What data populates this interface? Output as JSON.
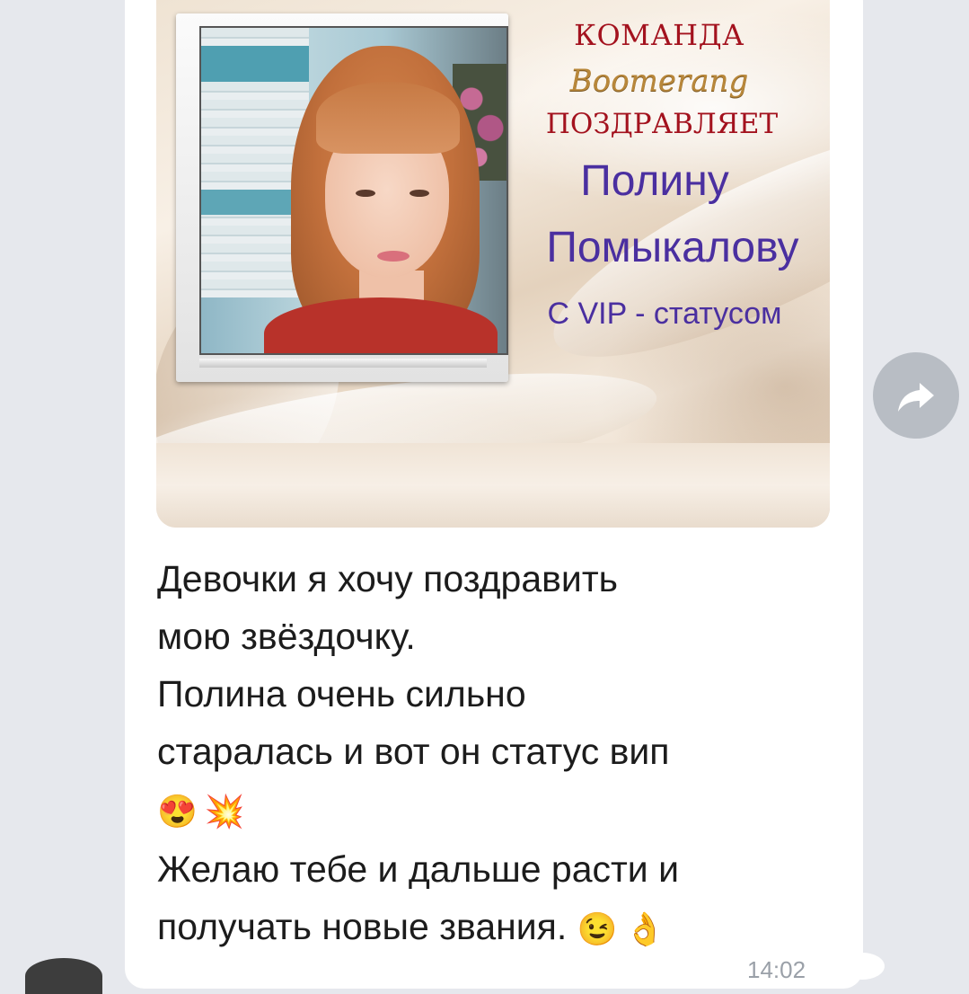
{
  "media": {
    "line_komanda": "КОМАНДА",
    "line_brand": "Boomerang",
    "line_congrats": "ПОЗДРАВЛЯЕТ",
    "line_name1": "Полину",
    "line_name2": "Помыкалову",
    "line_status": "С VIP - статусом"
  },
  "message": {
    "lines": [
      "Девочки я хочу поздравить",
      "мою звёздочку.",
      "Полина очень сильно",
      "старалась и вот он статус вип"
    ],
    "emoji_row_1": [
      "😍",
      "💥"
    ],
    "lines2": [
      "Желаю тебе и дальше расти и",
      "получать новые звания."
    ],
    "emoji_row_2": [
      "😉",
      "👌"
    ],
    "time": "14:02"
  },
  "icons": {
    "share": "share-arrow-icon"
  }
}
